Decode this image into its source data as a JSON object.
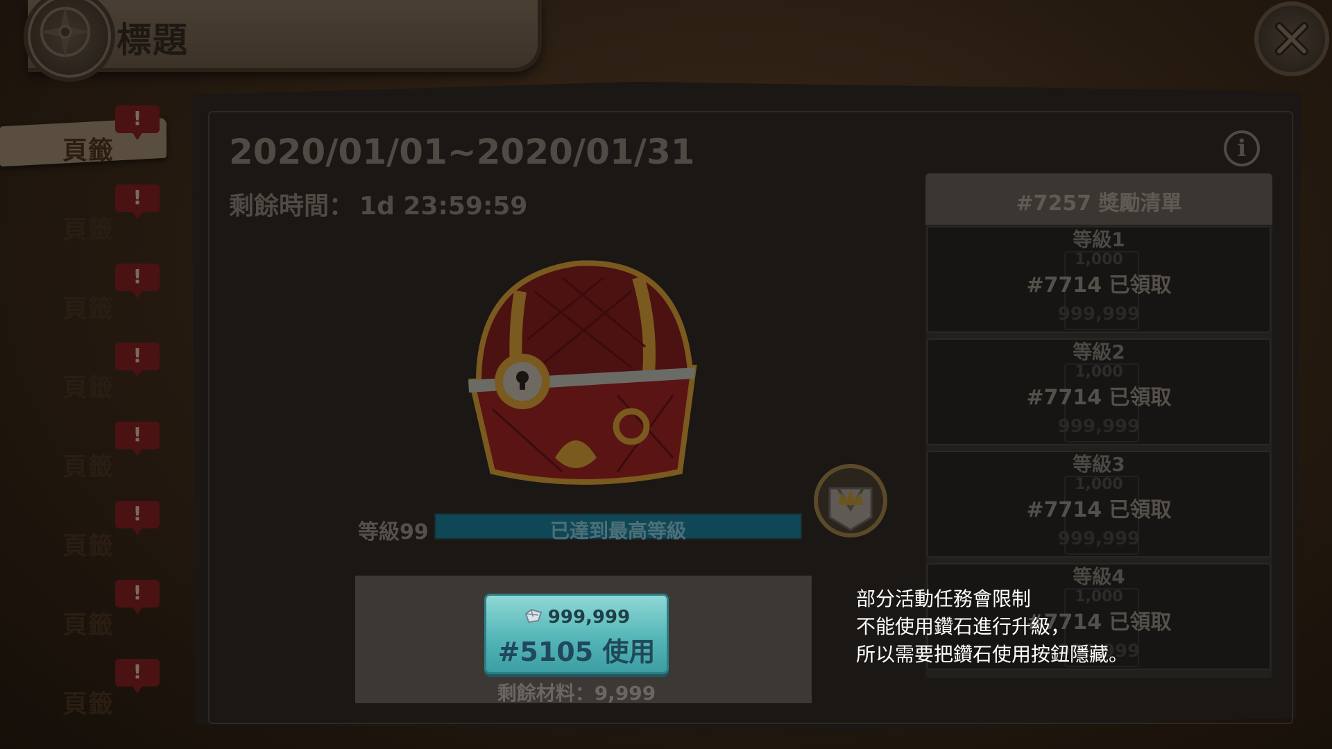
{
  "header": {
    "title": "標題"
  },
  "sidebar": {
    "tabs": [
      {
        "label": "頁籤",
        "badge": "!",
        "active": true
      },
      {
        "label": "頁籤",
        "badge": "!"
      },
      {
        "label": "頁籤",
        "badge": "!"
      },
      {
        "label": "頁籤",
        "badge": "!"
      },
      {
        "label": "頁籤",
        "badge": "!"
      },
      {
        "label": "頁籤",
        "badge": "!"
      },
      {
        "label": "頁籤",
        "badge": "!"
      },
      {
        "label": "頁籤",
        "badge": "!"
      }
    ]
  },
  "event": {
    "date_range": "2020/01/01~2020/01/31",
    "remaining_time_label": "剩餘時間：",
    "remaining_time_value": "1d 23:59:59",
    "level_label": "等級99",
    "level_status": "已達到最高等級",
    "level_progress": 1.0
  },
  "use_button": {
    "cost": "999,999",
    "label": "#5105 使用",
    "remaining_material": "剩餘材料：9,999"
  },
  "annotation": {
    "lines": [
      "部分活動任務會限制",
      "不能使用鑽石進行升級，",
      "所以需要把鑽石使用按鈕隱藏。"
    ]
  },
  "rewards": {
    "header": "#7257 獎勵清單",
    "items": [
      {
        "level": "等級1",
        "status": "#7714 已領取",
        "ghost_top": "1,000",
        "ghost_bottom": "999,999"
      },
      {
        "level": "等級2",
        "status": "#7714 已領取",
        "ghost_top": "1,000",
        "ghost_bottom": "999,999"
      },
      {
        "level": "等級3",
        "status": "#7714 已領取",
        "ghost_top": "1,000",
        "ghost_bottom": "999,999"
      },
      {
        "level": "等級4",
        "status": "#7714 已領取",
        "ghost_top": "1,000",
        "ghost_bottom": "999,999"
      }
    ]
  },
  "icons": {
    "close": "close-icon",
    "info": "info-icon",
    "compass": "compass-icon",
    "gem": "diamond-icon",
    "crown": "crown-badge-icon",
    "chest": "treasure-chest"
  },
  "colors": {
    "button_teal": "#55b6b8",
    "badge_red": "#4a1212",
    "level_bar": "#0e3a44",
    "annotation_text": "#ffffff"
  }
}
